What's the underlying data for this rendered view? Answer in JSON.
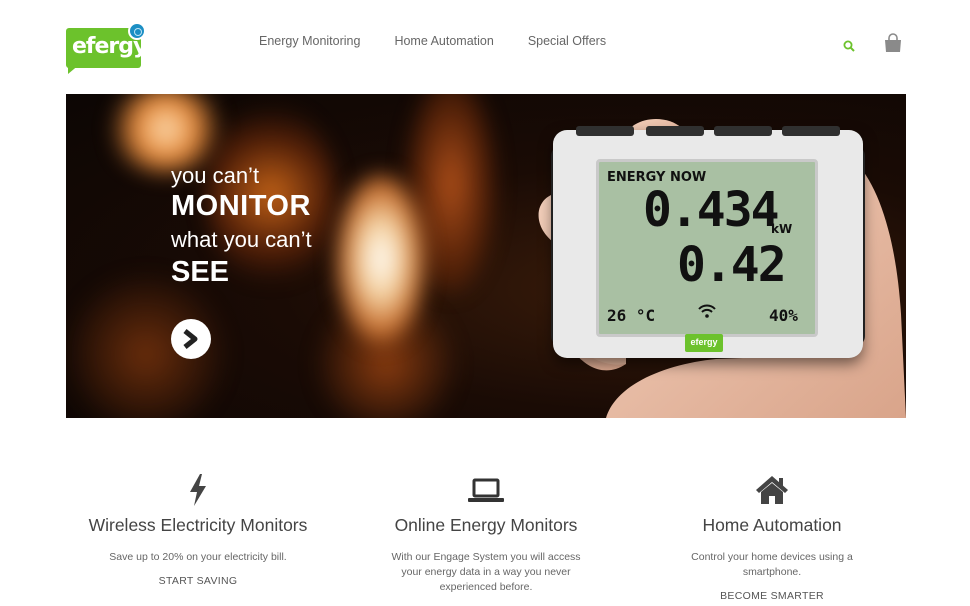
{
  "header": {
    "logo_text": "efergy",
    "nav": [
      {
        "label": "Energy Monitoring"
      },
      {
        "label": "Home Automation"
      },
      {
        "label": "Special Offers"
      }
    ],
    "accent_color": "#6cc22c"
  },
  "hero": {
    "line1": "you can’t",
    "line2": "MONITOR",
    "line3": "what you can’t",
    "line4": "SEE",
    "device": {
      "label": "ENERGY NOW",
      "reading1": "0.434",
      "unit": "kW",
      "reading2": "0.42",
      "temperature": "26 °C",
      "humidity": "40%",
      "logo": "efergy"
    }
  },
  "features": [
    {
      "icon": "lightning-icon",
      "title": "Wireless Electricity Monitors",
      "desc": "Save up to 20% on your electricity bill.",
      "link": "START SAVING"
    },
    {
      "icon": "laptop-icon",
      "title": "Online Energy Monitors",
      "desc": "With our Engage System you will access your energy data in a way you never experienced before.",
      "link": ""
    },
    {
      "icon": "house-icon",
      "title": "Home Automation",
      "desc": "Control your home devices using a smartphone.",
      "link": "BECOME SMARTER"
    }
  ]
}
